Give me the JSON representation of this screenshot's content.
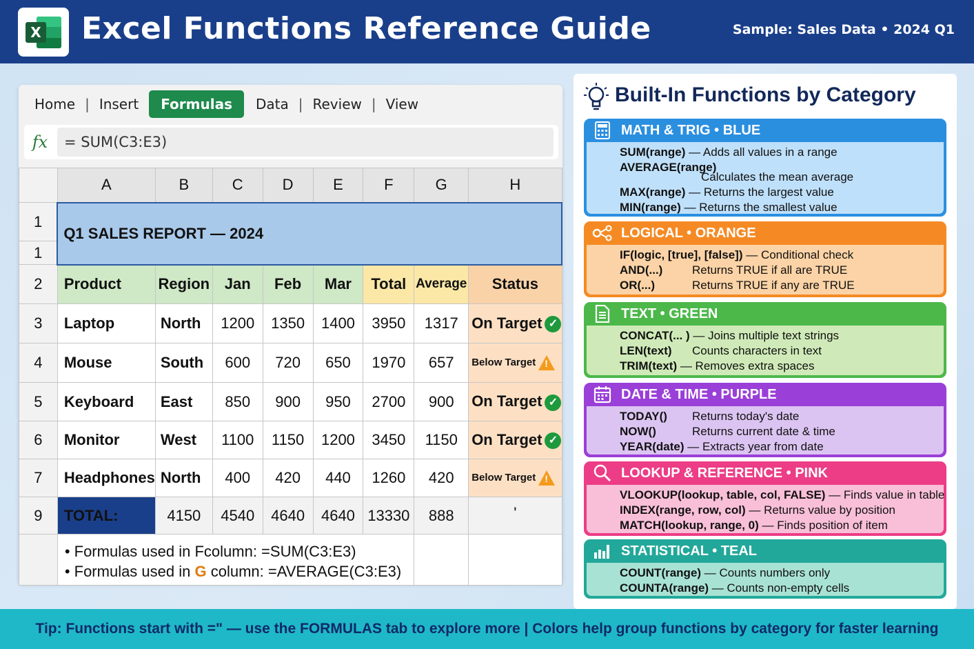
{
  "header": {
    "title": "Excel Functions Reference Guide",
    "sample": "Sample: Sales Data • 2024 Q1"
  },
  "ribbon": {
    "tabs": [
      "Home",
      "Insert",
      "Formulas",
      "Data",
      "Review",
      "View"
    ],
    "active": "Formulas"
  },
  "formula_bar": {
    "fx": "fx",
    "value": "= SUM(C3:E3)"
  },
  "sheet": {
    "columns": [
      "A",
      "B",
      "C",
      "D",
      "E",
      "F",
      "G",
      "H"
    ],
    "title_row_numbers": [
      "1",
      "1"
    ],
    "title": "Q1 SALES REPORT — 2024",
    "headers": [
      "Product",
      "Region",
      "Jan",
      "Feb",
      "Mar",
      "Total",
      "Average",
      "Status"
    ],
    "rows": [
      {
        "n": "3",
        "product": "Laptop",
        "region": "North",
        "jan": "1200",
        "feb": "1350",
        "mar": "1400",
        "total": "3950",
        "avg": "1317",
        "status": "On Target",
        "ok": true
      },
      {
        "n": "4",
        "product": "Mouse",
        "region": "South",
        "jan": "600",
        "feb": "720",
        "mar": "650",
        "total": "1970",
        "avg": "657",
        "status": "Below Target",
        "ok": false
      },
      {
        "n": "5",
        "product": "Keyboard",
        "region": "East",
        "jan": "850",
        "feb": "900",
        "mar": "950",
        "total": "2700",
        "avg": "900",
        "status": "On Target",
        "ok": true
      },
      {
        "n": "6",
        "product": "Monitor",
        "region": "West",
        "jan": "1100",
        "feb": "1150",
        "mar": "1200",
        "total": "3450",
        "avg": "1150",
        "status": "On Target",
        "ok": true
      },
      {
        "n": "7",
        "product": "Headphones",
        "region": "North",
        "jan": "400",
        "feb": "420",
        "mar": "440",
        "total": "1260",
        "avg": "420",
        "status": "Below Target",
        "ok": false
      }
    ],
    "total_row": {
      "n": "9",
      "label": "TOTAL:",
      "values": [
        "4150",
        "4540",
        "4640",
        "4640",
        "13330",
        "888"
      ],
      "h": "'"
    },
    "notes": {
      "line1": "• Formulas used in Fcolumn: =SUM(C3:E3)",
      "line2_pre": "• Formulas used in ",
      "line2_letter": "G",
      "line2_post": " column: =AVERAGE(C3:E3)"
    }
  },
  "categories_panel": {
    "title": "Built-In Functions by Category",
    "categories": [
      {
        "id": "math",
        "name": "MATH & TRIG • BLUE",
        "head": "#2b8fe0",
        "body": "#bfe0fa",
        "border": "#2b8fe0",
        "icon": "calculator-icon",
        "lines": [
          {
            "fn": "SUM(range)",
            "desc": " — Adds all values in a range"
          },
          {
            "fn": "AVERAGE(range)",
            "desc": ""
          },
          {
            "fn": "",
            "desc": "Calculates the mean average"
          },
          {
            "fn": "MAX(range)",
            "desc": " — Returns the largest value"
          },
          {
            "fn": "MIN(range)",
            "desc": " — Returns the smallest value"
          }
        ]
      },
      {
        "id": "logical",
        "name": "LOGICAL • ORANGE",
        "head": "#f58a24",
        "body": "#fcd3a6",
        "border": "#f58a24",
        "icon": "logic-icon",
        "lines": [
          {
            "fn": "IF(logic, [true], [false])",
            "desc": " — Conditional check"
          },
          {
            "fn": "AND(...)",
            "desc": "Returns TRUE if all are TRUE"
          },
          {
            "fn": "OR(...)",
            "desc": "Returns TRUE if any are TRUE"
          }
        ]
      },
      {
        "id": "text",
        "name": "TEXT • GREEN",
        "head": "#4cb84a",
        "body": "#cfeab8",
        "border": "#4cb84a",
        "icon": "document-icon",
        "lines": [
          {
            "fn": "CONCAT(... )",
            "desc": " — Joins multiple text strings"
          },
          {
            "fn": "LEN(text)",
            "desc": "Counts characters in text"
          },
          {
            "fn": "TRIM(text)",
            "desc": " — Removes extra spaces"
          }
        ]
      },
      {
        "id": "date",
        "name": "DATE & TIME • PURPLE",
        "head": "#9a3fd8",
        "body": "#dcc4f2",
        "border": "#9a3fd8",
        "icon": "calendar-icon",
        "lines": [
          {
            "fn": "TODAY()",
            "desc": "Returns today's date"
          },
          {
            "fn": "NOW()",
            "desc": "Returns current date & time"
          },
          {
            "fn": "YEAR(date)",
            "desc": " — Extracts year from date"
          }
        ]
      },
      {
        "id": "lookup",
        "name": "LOOKUP & REFERENCE • PINK",
        "head": "#ec3d86",
        "body": "#f9bfd8",
        "border": "#ec3d86",
        "icon": "magnifier-icon",
        "lines": [
          {
            "fn": "VLOOKUP(lookup, table, col, FALSE)",
            "desc": " — Finds value in table"
          },
          {
            "fn": "INDEX(range, row, col)",
            "desc": " — Returns value by position"
          },
          {
            "fn": "MATCH(lookup, range, 0)",
            "desc": " — Finds position of item"
          }
        ]
      },
      {
        "id": "stat",
        "name": "STATISTICAL • TEAL",
        "head": "#22a89a",
        "body": "#a8e2d4",
        "border": "#22a89a",
        "icon": "bar-chart-icon",
        "lines": [
          {
            "fn": "COUNT(range)",
            "desc": " — Counts numbers only"
          },
          {
            "fn": "COUNTA(range)",
            "desc": " — Counts non-empty cells"
          }
        ]
      }
    ]
  },
  "footer": {
    "tip": "Tip: Functions start with =\" — use the FORMULAS tab to explore more  |  Colors help group functions by category for faster learning"
  }
}
